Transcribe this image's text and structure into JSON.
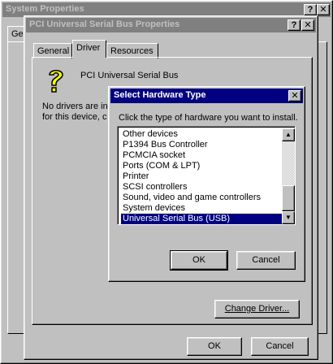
{
  "system_properties": {
    "title": "System Properties",
    "help_btn": "?",
    "close_btn": "✕",
    "tab_fragment": "Ge"
  },
  "usb_properties": {
    "title": "PCI Universal Serial Bus Properties",
    "help_btn": "?",
    "close_btn": "✕",
    "tabs": [
      {
        "label": "General"
      },
      {
        "label": "Driver"
      },
      {
        "label": "Resources"
      }
    ],
    "device_name": "PCI Universal Serial Bus",
    "info_line1": "No drivers are in",
    "info_line2": "for this device, c",
    "change_driver_button": "Change Driver...",
    "ok_button": "OK",
    "cancel_button": "Cancel"
  },
  "hardware_dialog": {
    "title": "Select Hardware Type",
    "close_btn": "✕",
    "prompt": "Click the type of hardware you want to install.",
    "items": [
      {
        "label": "Other devices"
      },
      {
        "label": "P1394 Bus Controller"
      },
      {
        "label": "PCMCIA socket"
      },
      {
        "label": "Ports (COM & LPT)"
      },
      {
        "label": "Printer"
      },
      {
        "label": "SCSI controllers"
      },
      {
        "label": "Sound, video and game controllers"
      },
      {
        "label": "System devices"
      },
      {
        "label": "Universal Serial Bus (USB)"
      }
    ],
    "selected_item": "Universal Serial Bus (USB)",
    "ok_button": "OK",
    "cancel_button": "Cancel"
  },
  "icons": {
    "help_device_icon": "question-mark-icon",
    "scroll_up": "scroll-up-arrow-icon",
    "scroll_down": "scroll-down-arrow-icon"
  },
  "colors": {
    "face": "#c0c0c0",
    "active_title": "#000080",
    "inactive_title": "#808080",
    "selection": "#000080"
  }
}
